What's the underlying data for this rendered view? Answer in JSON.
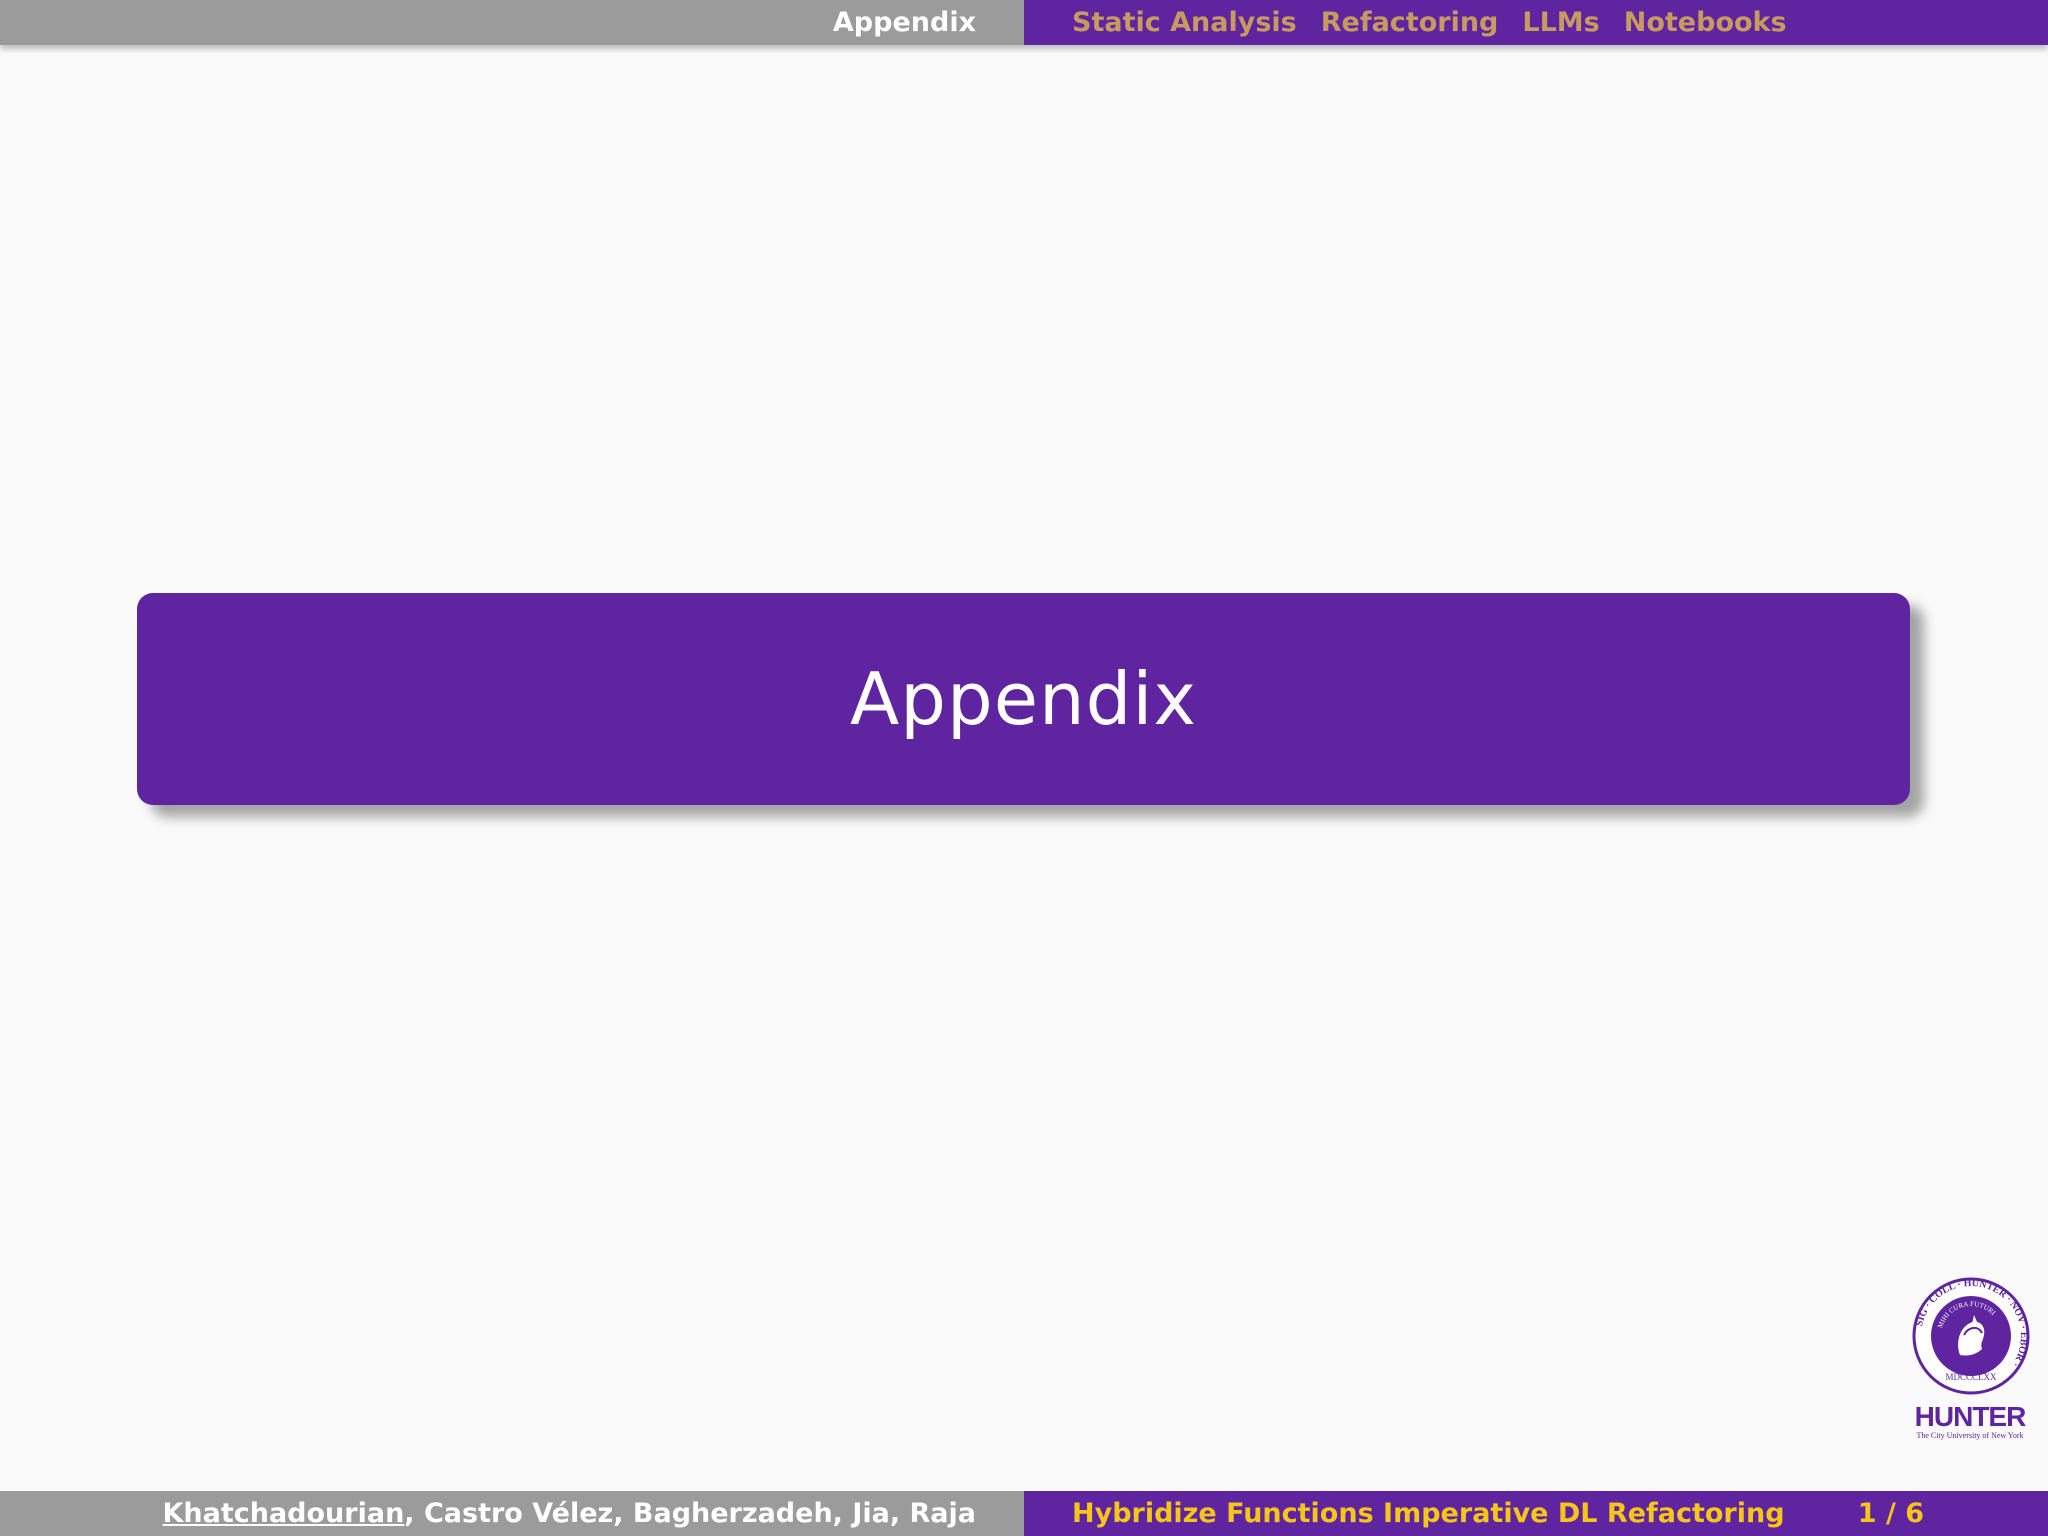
{
  "header": {
    "current_section": "Appendix",
    "nav": [
      {
        "label": "Static Analysis"
      },
      {
        "label": "Refactoring"
      },
      {
        "label": "LLMs"
      },
      {
        "label": "Notebooks"
      }
    ]
  },
  "slide": {
    "title": "Appendix"
  },
  "logo": {
    "seal_text_outer": "SIG · COLL · HUNTER · NOV · EBOR ·",
    "seal_text_inner": "MIHI CURA FUTURI",
    "seal_year": "MDCCCLXX",
    "wordmark": "HUNTER",
    "subline": "The City University of New York"
  },
  "footer": {
    "lead_author": "Khatchadourian",
    "other_authors": ", Castro Vélez, Bagherzadeh, Jia, Raja",
    "short_title": "Hybridize Functions Imperative DL Refactoring",
    "page": "1 / 6"
  },
  "colors": {
    "purple": "#5f249f",
    "gray": "#9b9b9b",
    "nav_text": "#c79a5f",
    "footer_title": "#f5c518",
    "background": "#fafafa"
  }
}
